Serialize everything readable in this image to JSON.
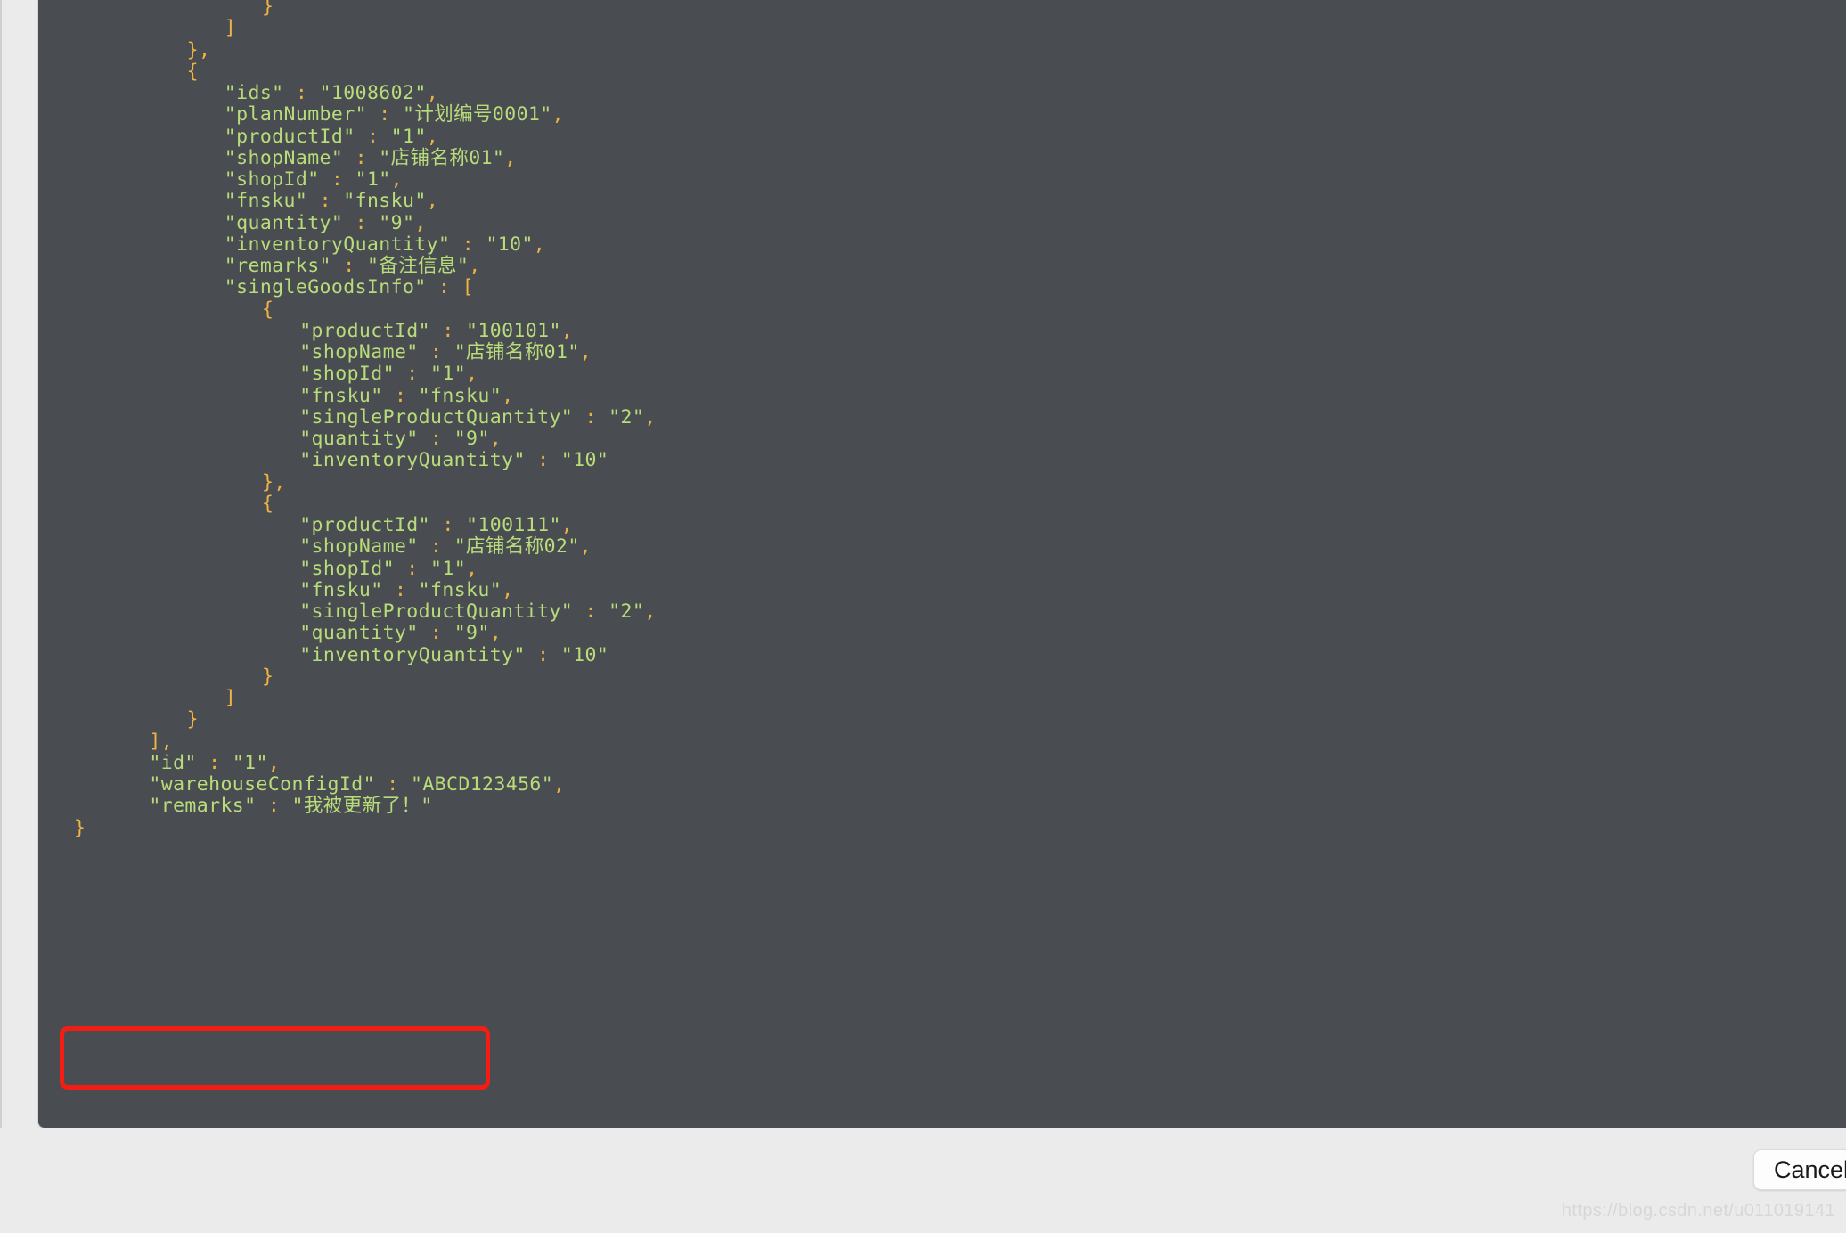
{
  "window": {
    "background_color": "#ebebeb",
    "panel_background_color": "#494d51"
  },
  "annotation": {
    "name": "red-highlight-rectangle",
    "color": "#f41d14",
    "border_width_px": 5,
    "highlights_lines": [
      "\"warehouseConfigId\" : \"ABCD123456\",",
      "\"remarks\" : \"我被更新了！\""
    ]
  },
  "syntax_colors": {
    "key": "#b9dc7b",
    "string": "#b9dc7b",
    "punctuation": "#e8b248",
    "brace": "#f2b342",
    "background": "#494d51"
  },
  "footer": {
    "cancel_button_label": "Cancel",
    "watermark": "https://blog.csdn.net/u011019141"
  },
  "response_body": {
    "language": "json",
    "lines": [
      {
        "indent": 5,
        "tokens": [
          {
            "t": "}",
            "c": "b"
          }
        ]
      },
      {
        "indent": 4,
        "tokens": [
          {
            "t": "]",
            "c": "b"
          }
        ]
      },
      {
        "indent": 3,
        "tokens": [
          {
            "t": "},",
            "c": "b"
          }
        ]
      },
      {
        "indent": 3,
        "tokens": [
          {
            "t": "{",
            "c": "b"
          }
        ]
      },
      {
        "indent": 4,
        "key": "\"ids\"",
        "value": "\"1008602\"",
        "comma": true
      },
      {
        "indent": 4,
        "key": "\"planNumber\"",
        "value": "\"计划编号0001\"",
        "comma": true
      },
      {
        "indent": 4,
        "key": "\"productId\"",
        "value": "\"1\"",
        "comma": true
      },
      {
        "indent": 4,
        "key": "\"shopName\"",
        "value": "\"店铺名称01\"",
        "comma": true
      },
      {
        "indent": 4,
        "key": "\"shopId\"",
        "value": "\"1\"",
        "comma": true
      },
      {
        "indent": 4,
        "key": "\"fnsku\"",
        "value": "\"fnsku\"",
        "comma": true
      },
      {
        "indent": 4,
        "key": "\"quantity\"",
        "value": "\"9\"",
        "comma": true
      },
      {
        "indent": 4,
        "key": "\"inventoryQuantity\"",
        "value": "\"10\"",
        "comma": true
      },
      {
        "indent": 4,
        "key": "\"remarks\"",
        "value": "\"备注信息\"",
        "comma": true
      },
      {
        "indent": 4,
        "key": "\"singleGoodsInfo\"",
        "value": "[",
        "value_class": "b",
        "comma": false
      },
      {
        "indent": 5,
        "tokens": [
          {
            "t": "{",
            "c": "b"
          }
        ]
      },
      {
        "indent": 6,
        "key": "\"productId\"",
        "value": "\"100101\"",
        "comma": true
      },
      {
        "indent": 6,
        "key": "\"shopName\"",
        "value": "\"店铺名称01\"",
        "comma": true
      },
      {
        "indent": 6,
        "key": "\"shopId\"",
        "value": "\"1\"",
        "comma": true
      },
      {
        "indent": 6,
        "key": "\"fnsku\"",
        "value": "\"fnsku\"",
        "comma": true
      },
      {
        "indent": 6,
        "key": "\"singleProductQuantity\"",
        "value": "\"2\"",
        "comma": true
      },
      {
        "indent": 6,
        "key": "\"quantity\"",
        "value": "\"9\"",
        "comma": true
      },
      {
        "indent": 6,
        "key": "\"inventoryQuantity\"",
        "value": "\"10\"",
        "comma": false
      },
      {
        "indent": 5,
        "tokens": [
          {
            "t": "},",
            "c": "b"
          }
        ]
      },
      {
        "indent": 5,
        "tokens": [
          {
            "t": "{",
            "c": "b"
          }
        ]
      },
      {
        "indent": 6,
        "key": "\"productId\"",
        "value": "\"100111\"",
        "comma": true
      },
      {
        "indent": 6,
        "key": "\"shopName\"",
        "value": "\"店铺名称02\"",
        "comma": true
      },
      {
        "indent": 6,
        "key": "\"shopId\"",
        "value": "\"1\"",
        "comma": true
      },
      {
        "indent": 6,
        "key": "\"fnsku\"",
        "value": "\"fnsku\"",
        "comma": true
      },
      {
        "indent": 6,
        "key": "\"singleProductQuantity\"",
        "value": "\"2\"",
        "comma": true
      },
      {
        "indent": 6,
        "key": "\"quantity\"",
        "value": "\"9\"",
        "comma": true
      },
      {
        "indent": 6,
        "key": "\"inventoryQuantity\"",
        "value": "\"10\"",
        "comma": false
      },
      {
        "indent": 5,
        "tokens": [
          {
            "t": "}",
            "c": "b"
          }
        ]
      },
      {
        "indent": 4,
        "tokens": [
          {
            "t": "]",
            "c": "b"
          }
        ]
      },
      {
        "indent": 3,
        "tokens": [
          {
            "t": "}",
            "c": "b"
          }
        ]
      },
      {
        "indent": 2,
        "tokens": [
          {
            "t": "],",
            "c": "b"
          }
        ]
      },
      {
        "indent": 2,
        "key": "\"id\"",
        "value": "\"1\"",
        "comma": true
      },
      {
        "indent": 2,
        "key": "\"warehouseConfigId\"",
        "value": "\"ABCD123456\"",
        "comma": true,
        "highlighted": true
      },
      {
        "indent": 2,
        "key": "\"remarks\"",
        "value": "\"我被更新了！\"",
        "comma": false,
        "highlighted": true
      },
      {
        "indent": 0,
        "tokens": [
          {
            "t": "}",
            "c": "b"
          }
        ]
      }
    ]
  }
}
